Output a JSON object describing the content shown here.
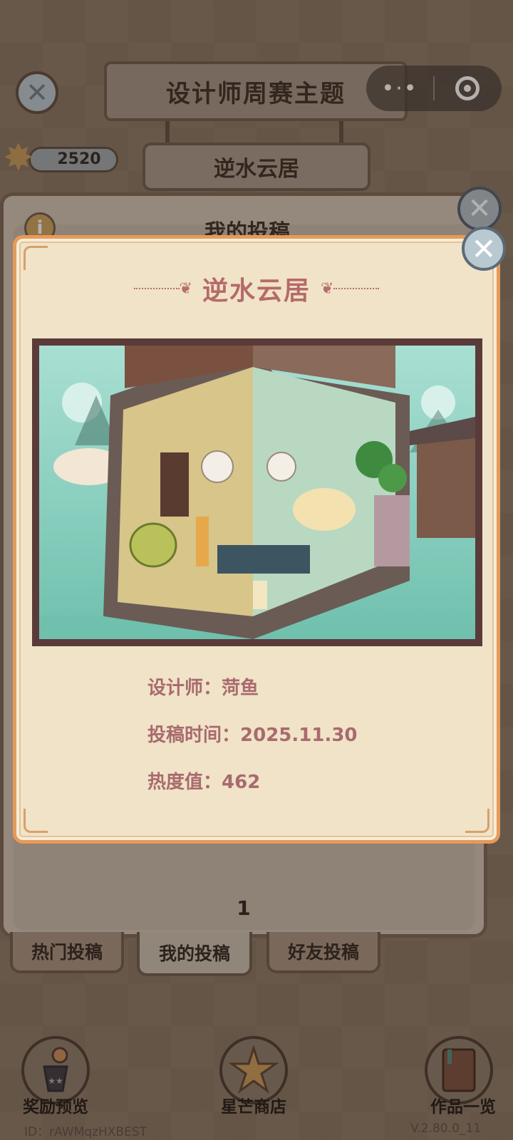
{
  "header": {
    "title": "设计师周赛主题",
    "theme_name": "逆水云居",
    "star_count": "2520",
    "capsule_more": "•·•"
  },
  "back_panel": {
    "title": "我的投稿",
    "page_number": "1",
    "tabs": [
      {
        "label": "热门投稿",
        "active": false
      },
      {
        "label": "我的投稿",
        "active": true
      },
      {
        "label": "好友投稿",
        "active": false
      }
    ]
  },
  "modal": {
    "title": "逆水云居",
    "designer_label": "设计师：",
    "designer": "菏鱼",
    "submit_time_label": "投稿时间：",
    "submit_time": "2025.11.30",
    "heat_label": "热度值：",
    "heat": "462"
  },
  "bottom_nav": [
    {
      "label": "奖励预览",
      "icon": "trophy-icon"
    },
    {
      "label": "星芒商店",
      "icon": "star-icon"
    },
    {
      "label": "作品一览",
      "icon": "book-icon"
    }
  ],
  "footer": {
    "id_text": "ID：rAWMqzHXBEST",
    "version": "V.2.80.0_11"
  },
  "colors": {
    "modal_bg": "#f0e3c8",
    "modal_border": "#e69a5a",
    "accent_text": "#b56a6a",
    "art_water": "#7ec8b6"
  }
}
